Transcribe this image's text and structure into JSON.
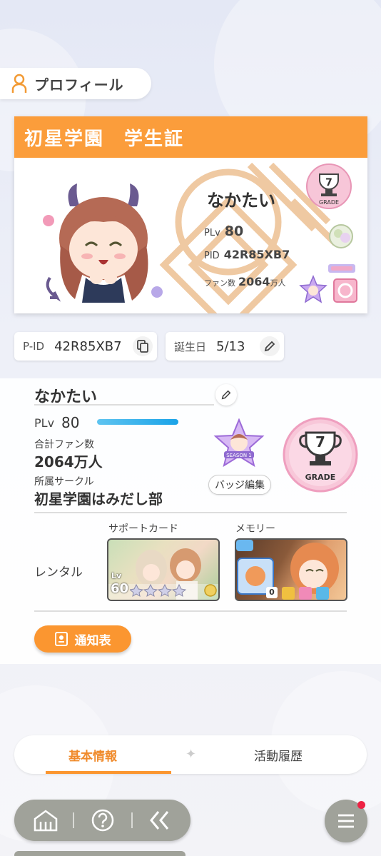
{
  "header": {
    "title": "プロフィール",
    "icon": "person-icon"
  },
  "student_card": {
    "title": "初星学園　学生証",
    "name": "なかたい",
    "plv_label": "PLv",
    "plv_value": "80",
    "pid_label": "PID",
    "pid_value": "42R85XB7",
    "fans_label": "ファン数",
    "fans_value": "2064",
    "fans_unit": "万人",
    "grade_label": "GRADE",
    "grade_value": "7",
    "accent_color": "#fb9d3b"
  },
  "id_chip": {
    "label": "P-ID",
    "value": "42R85XB7",
    "icon": "copy-icon"
  },
  "birthday_chip": {
    "label": "誕生日",
    "value": "5/13",
    "icon": "pencil-icon"
  },
  "profile": {
    "name": "なかたい",
    "plv_label": "PLv",
    "plv_value": "80",
    "total_fans_label": "合計ファン数",
    "total_fans_value": "2064万人",
    "circle_label": "所属サークル",
    "circle_value": "初星学園はみだし部",
    "badge_button": "バッジ編集",
    "badge_season": "SEASON 1",
    "grade_label": "GRADE",
    "grade_value": "7"
  },
  "rental": {
    "label": "レンタル",
    "support_label": "サポートカード",
    "support_level_prefix": "Lv",
    "support_level": "60",
    "memory_label": "メモリー",
    "memory_count": "0"
  },
  "notice_button": {
    "label": "通知表"
  },
  "tabs": [
    {
      "label": "基本情報",
      "active": true
    },
    {
      "label": "活動履歴",
      "active": false
    }
  ],
  "nav": {
    "home": "home-icon",
    "help": "help-icon",
    "back": "back-icon",
    "menu": "menu-icon",
    "notification_color": "#ee2244"
  }
}
